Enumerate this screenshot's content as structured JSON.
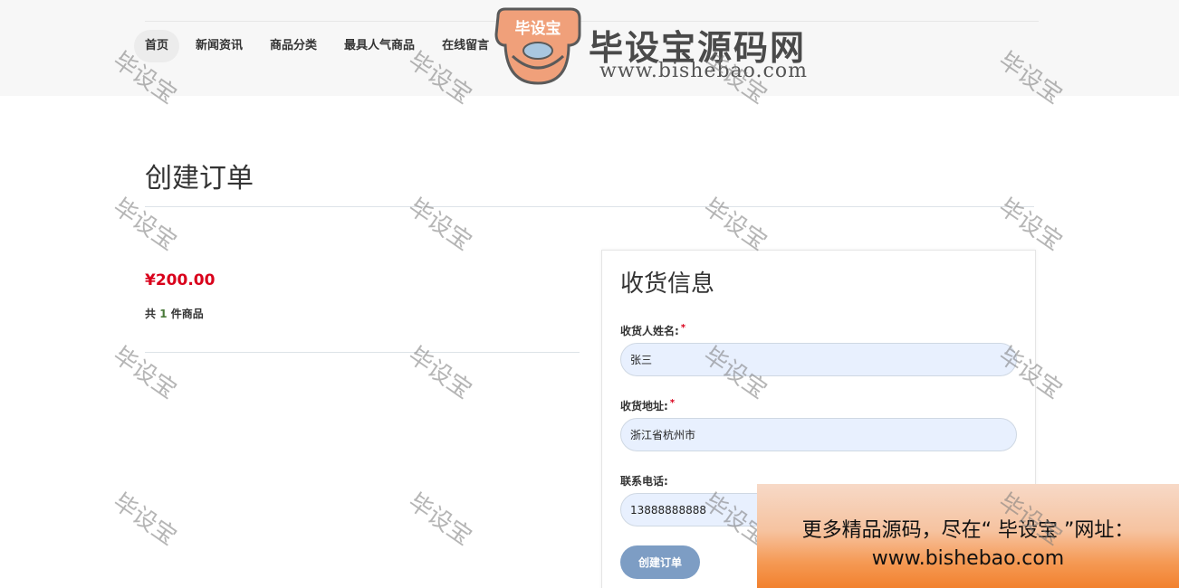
{
  "nav": {
    "items": [
      "首页",
      "新闻资讯",
      "商品分类",
      "最具人气商品",
      "在线留言"
    ]
  },
  "logo": {
    "badge_text": "毕设宝",
    "title": "毕设宝源码网",
    "url": "www.bishebao.com"
  },
  "page": {
    "title": "创建订单"
  },
  "summary": {
    "price": "¥200.00",
    "count_prefix": "共",
    "count": "1",
    "count_suffix": "件商品"
  },
  "shipping": {
    "title": "收货信息",
    "name_label": "收货人姓名:",
    "name_value": "张三",
    "address_label": "收货地址:",
    "address_value": "浙江省杭州市",
    "phone_label": "联系电话:",
    "phone_value": "13888888888",
    "required_mark": "*",
    "submit_label": "创建订单"
  },
  "watermark": {
    "text": "毕设宝"
  },
  "promo": {
    "line1": "更多精品源码，尽在“ 毕设宝 ”网址：",
    "line2": "www.bishebao.com"
  },
  "colors": {
    "price": "#d9001b",
    "button": "#7d9dc4",
    "input_bg": "#e8f0fe",
    "logo_orange": "#f0a07a"
  }
}
